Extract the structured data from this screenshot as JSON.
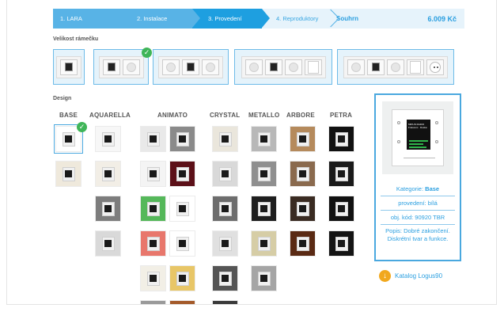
{
  "stepper": {
    "steps": [
      {
        "label": "1. LARA",
        "state": "done"
      },
      {
        "label": "2. Instalace",
        "state": "done"
      },
      {
        "label": "3. Provedení",
        "state": "active"
      },
      {
        "label": "4. Reproduktory",
        "state": "pending"
      }
    ],
    "summary_label": "Souhrn",
    "price": "6.009 Kč"
  },
  "frame_section": {
    "title": "Velikost rámečku",
    "options": [
      {
        "name": "1-fold",
        "modules": [
          "screen"
        ],
        "selected": false
      },
      {
        "name": "2-fold",
        "modules": [
          "screen",
          "speaker"
        ],
        "selected": true
      },
      {
        "name": "3-fold",
        "modules": [
          "speaker",
          "screen",
          "speaker"
        ],
        "selected": false
      },
      {
        "name": "4-fold",
        "modules": [
          "speaker",
          "screen",
          "speaker",
          "rocker"
        ],
        "selected": false
      },
      {
        "name": "5-fold",
        "modules": [
          "speaker",
          "screen",
          "speaker",
          "rocker",
          "socket"
        ],
        "selected": false
      }
    ]
  },
  "design_section": {
    "title": "Design",
    "columns": [
      {
        "label": "BASE"
      },
      {
        "label": "AQUARELLA"
      },
      {
        "label": "ANIMATO"
      },
      {
        "label": "CRYSTAL"
      },
      {
        "label": "METALLO"
      },
      {
        "label": "ARBORE"
      },
      {
        "label": "PETRA"
      }
    ]
  },
  "preview": {
    "device_screen_text": [
      "MIPLIS RADIO",
      "Frekvenc · Doska"
    ],
    "kategorie_label": "Kategorie:",
    "kategorie_value": "Base",
    "provedeni": "provedení: bílá",
    "obj_kod": "obj. kód: 90920 TBR",
    "popis": "Popis: Dobré zakončení. Diskrétní tvar a funkce."
  },
  "catalog": {
    "label": "Katalog Logus90",
    "icon": "download-icon"
  },
  "colors": {
    "accent": "#1e9fe0",
    "accent_light": "#e6f3fb",
    "check": "#3fb558",
    "catalog_icon": "#f1a81e"
  }
}
